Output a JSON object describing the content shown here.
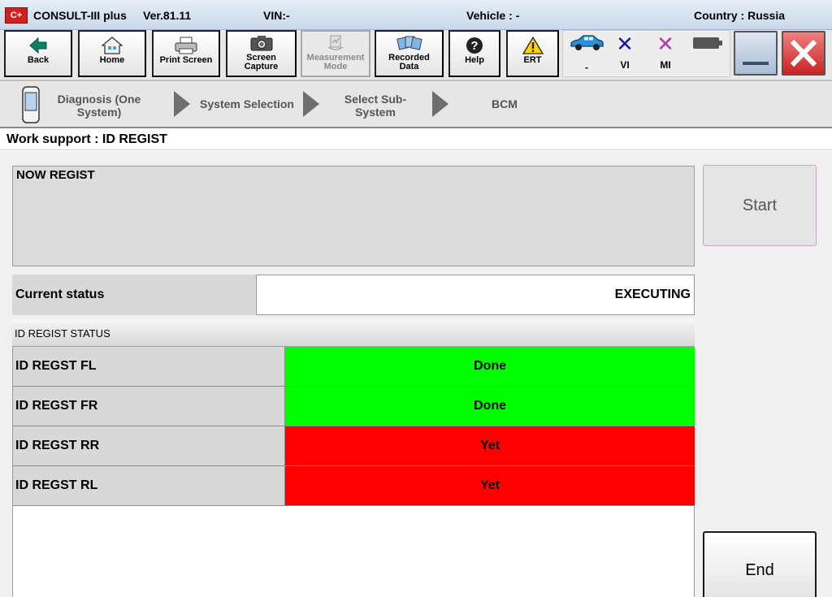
{
  "titlebar": {
    "logo": "C+",
    "app_name": "CONSULT-III plus",
    "version": "Ver.81.11",
    "vin": "VIN:-",
    "vehicle": "Vehicle : -",
    "country": "Country : Russia"
  },
  "toolbar": {
    "back": "Back",
    "home": "Home",
    "print": "Print Screen",
    "capture": "Screen Capture",
    "measurement": "Measurement Mode",
    "recorded": "Recorded Data",
    "help": "Help",
    "ert": "ERT"
  },
  "status": {
    "car": "-",
    "vi": "VI",
    "mi": "MI",
    "vi_color": "#1a1ab0",
    "mi_color": "#b03cb0"
  },
  "breadcrumb": {
    "step1": "Diagnosis (One System)",
    "step2": "System Selection",
    "step3": "Select Sub-System",
    "step4": "BCM"
  },
  "work": {
    "label": "Work support : ID REGIST",
    "now_regist": "NOW REGIST",
    "current_status_label": "Current status",
    "current_status_value": "EXECUTING",
    "status_header": "ID REGIST STATUS",
    "rows": [
      {
        "name": "ID REGST FL",
        "value": "Done",
        "color": "#00ff00"
      },
      {
        "name": "ID REGST FR",
        "value": "Done",
        "color": "#00ff00"
      },
      {
        "name": "ID REGST RR",
        "value": "Yet",
        "color": "#ff0000"
      },
      {
        "name": "ID REGST RL",
        "value": "Yet",
        "color": "#ff0000"
      }
    ],
    "start": "Start",
    "end": "End"
  }
}
